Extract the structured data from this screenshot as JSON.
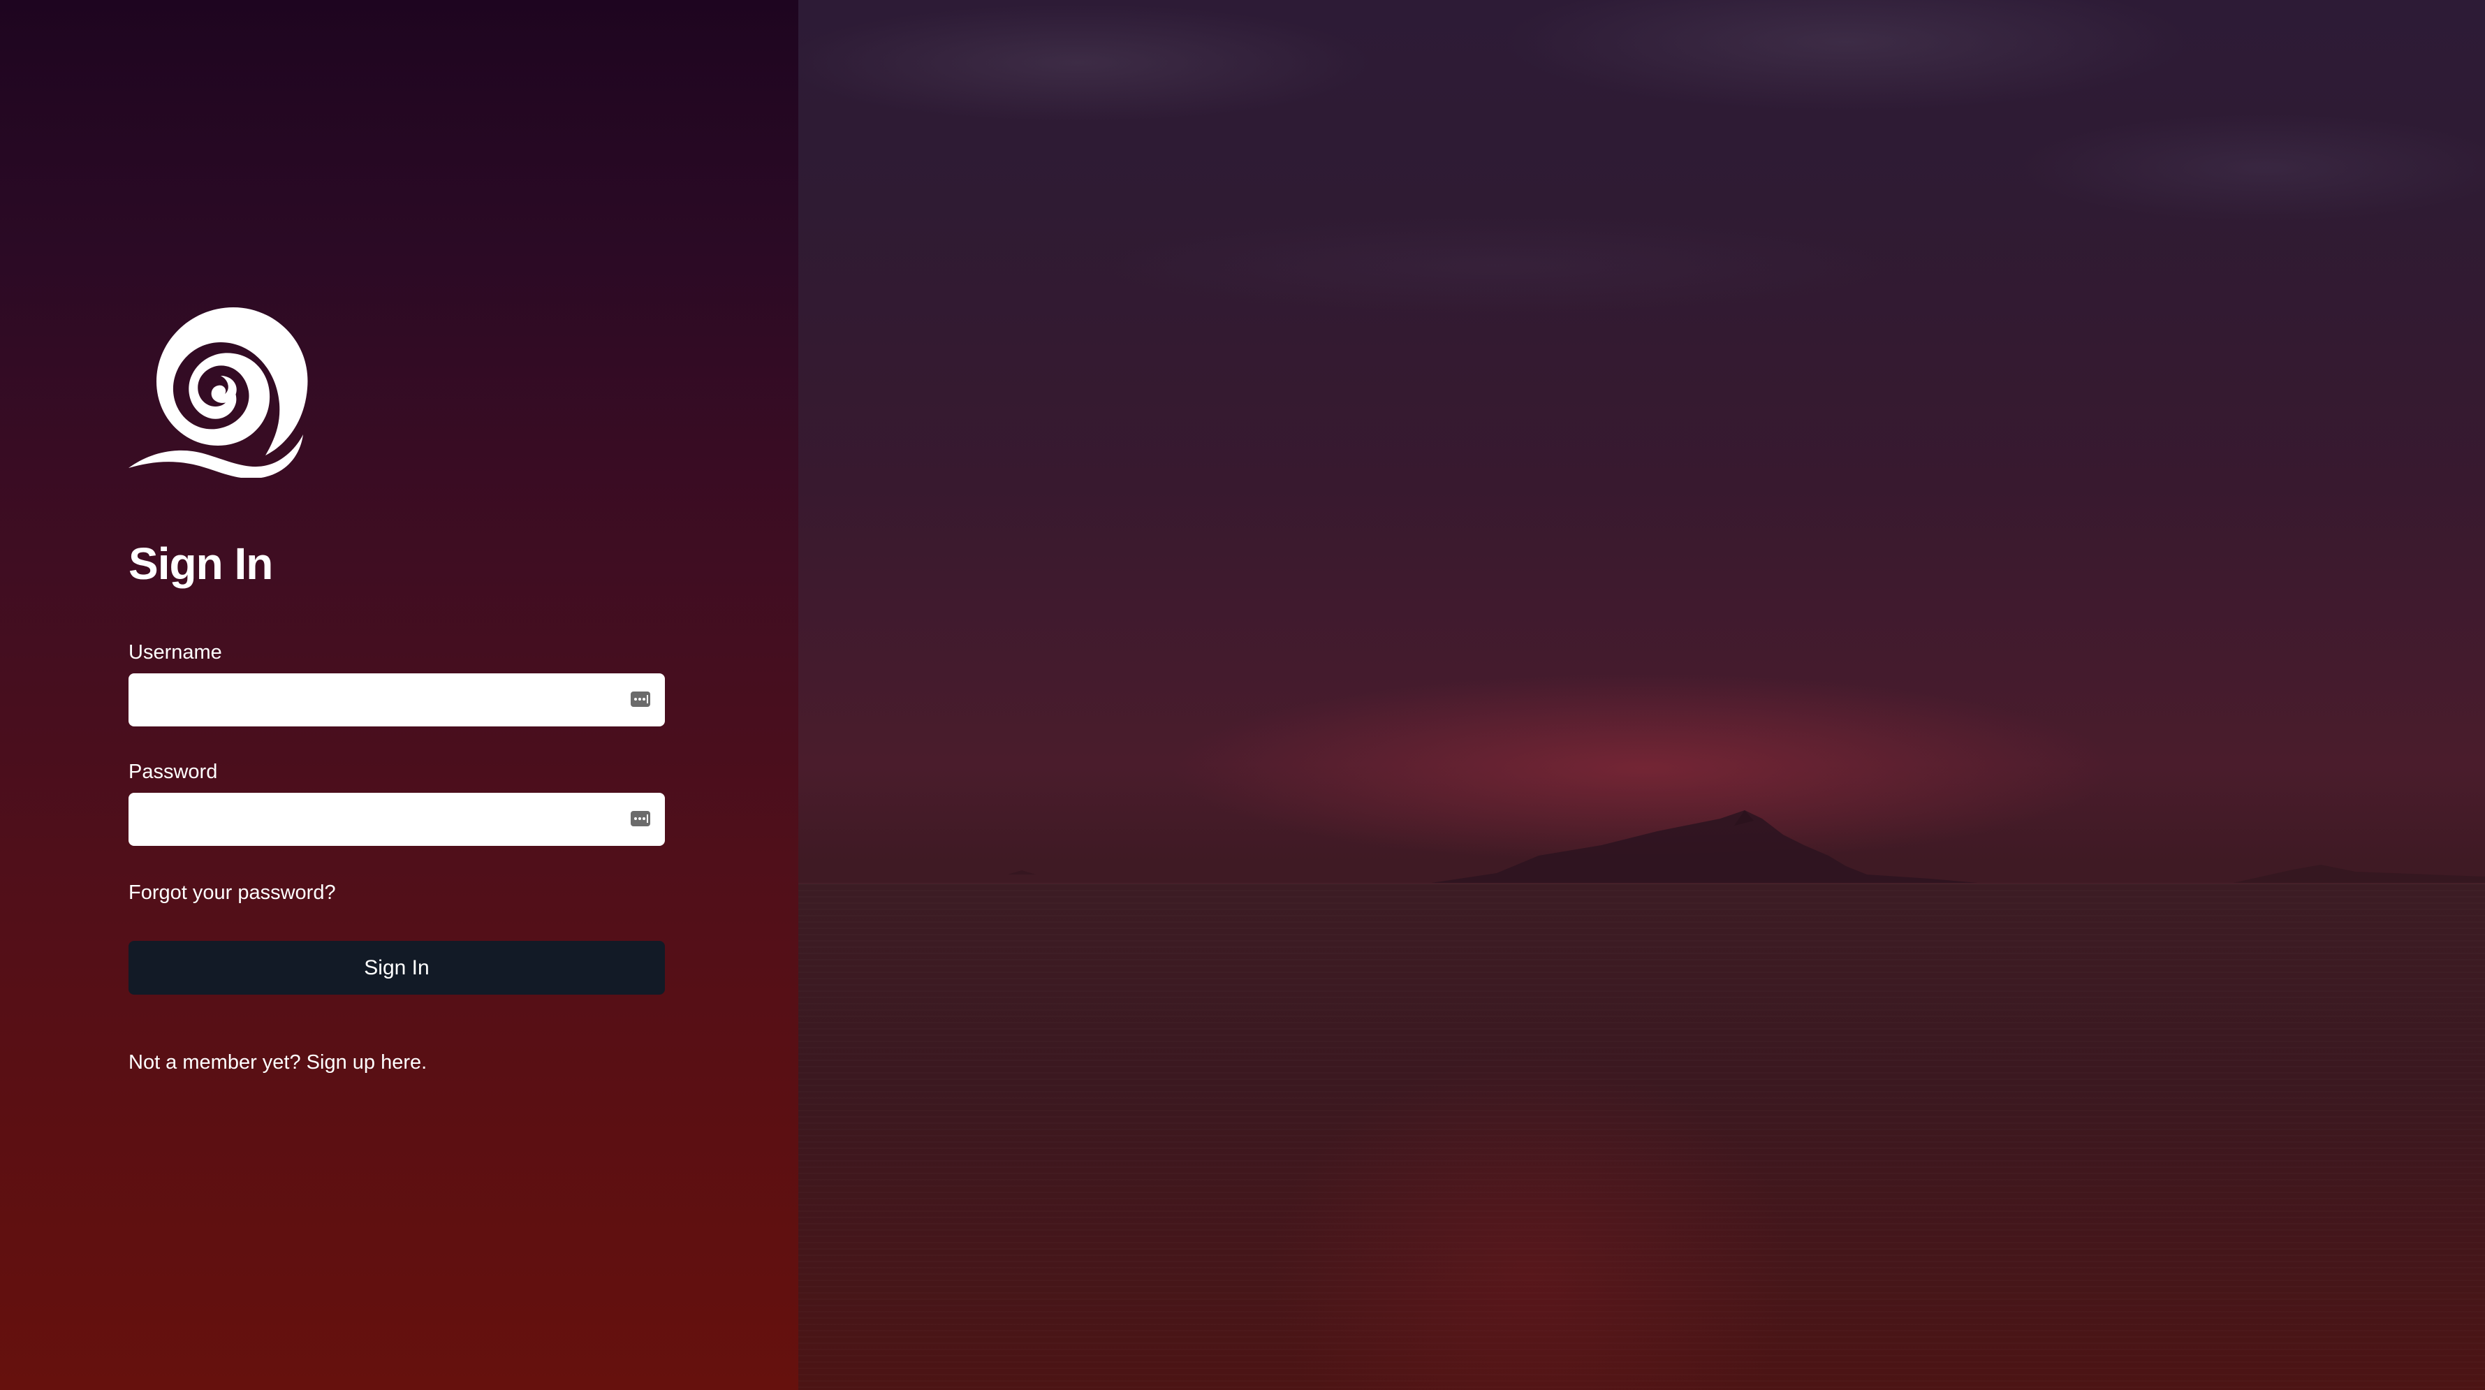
{
  "brand": {
    "logo_icon": "spiral-wave-logo"
  },
  "form": {
    "title": "Sign In",
    "username": {
      "label": "Username",
      "value": "",
      "icon": "password-manager-icon"
    },
    "password": {
      "label": "Password",
      "value": "",
      "icon": "password-manager-icon"
    },
    "forgot_link": "Forgot your password?",
    "submit_label": "Sign In",
    "signup_link": "Not a member yet? Sign up here."
  },
  "colors": {
    "panel_top": "#1e0520",
    "panel_bottom": "#66110d",
    "button_bg": "#121a26",
    "text": "#ffffff"
  },
  "background": {
    "icon": "sunset-sea-island-image"
  }
}
